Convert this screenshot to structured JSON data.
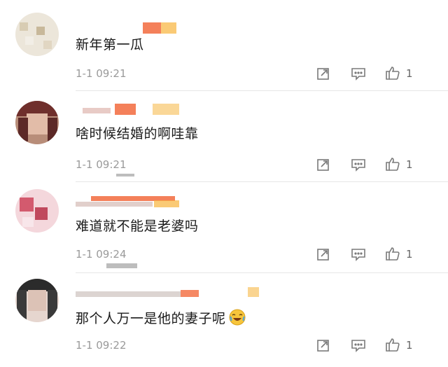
{
  "comments": [
    {
      "text": "新年第一瓜",
      "time": "1-1 09:21",
      "likes": "1",
      "avatar_colors": [
        "#e9e2d4",
        "#d8ccb3",
        "#f0ece4"
      ]
    },
    {
      "text": "啥时候结婚的啊哇靠",
      "time": "1-1 09:21",
      "likes": "1",
      "avatar_colors": [
        "#6f2f2c",
        "#c9a08a",
        "#e8c9b8"
      ]
    },
    {
      "text": "难道就不能是老婆吗",
      "time": "1-1 09:24",
      "likes": "1",
      "avatar_colors": [
        "#d35a6e",
        "#f3c4cc",
        "#f8e6ea"
      ]
    },
    {
      "text": "那个人万一是他的妻子呢",
      "time": "1-1 09:22",
      "likes": "1",
      "avatar_colors": [
        "#2b2b2b",
        "#d9bfb4",
        "#f1e4df"
      ]
    }
  ],
  "icons": {
    "share": "share-icon",
    "comment": "comment-icon",
    "like": "thumbs-up-icon",
    "emoji": "laughing-crying-emoji-icon"
  },
  "colors": {
    "name_redact_1": "#f26a3d",
    "name_redact_2": "#f8b43a",
    "divider": "#e6e6e6",
    "meta": "#9a9a9a"
  }
}
